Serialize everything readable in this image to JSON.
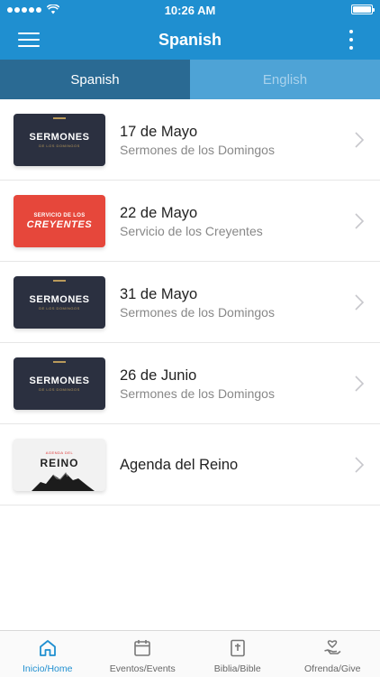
{
  "status_bar": {
    "time": "10:26 AM"
  },
  "header": {
    "title": "Spanish"
  },
  "tabs": [
    {
      "label": "Spanish",
      "active": true
    },
    {
      "label": "English",
      "active": false
    }
  ],
  "items": [
    {
      "title": "17 de Mayo",
      "subtitle": "Sermones de los Domingos",
      "thumb": {
        "main": "SERMONES",
        "sub": "DE LOS DOMINGOS"
      }
    },
    {
      "title": "22 de Mayo",
      "subtitle": "Servicio de los Creyentes",
      "thumb": {
        "line1": "SERVICIO DE LOS",
        "line2": "CREYENTES"
      }
    },
    {
      "title": "31 de Mayo",
      "subtitle": "Sermones de los Domingos",
      "thumb": {
        "main": "SERMONES",
        "sub": "DE LOS DOMINGOS"
      }
    },
    {
      "title": "26 de Junio",
      "subtitle": "Sermones de los Domingos",
      "thumb": {
        "main": "SERMONES",
        "sub": "DE LOS DOMINGOS"
      }
    },
    {
      "title": "Agenda del Reino",
      "thumb": {
        "top": "AGENDA DEL",
        "main": "REINO"
      }
    }
  ],
  "tabbar": [
    {
      "label": "Inicio/Home",
      "icon": "home-icon",
      "active": true
    },
    {
      "label": "Eventos/Events",
      "icon": "calendar-icon",
      "active": false
    },
    {
      "label": "Biblia/Bible",
      "icon": "bible-icon",
      "active": false
    },
    {
      "label": "Ofrenda/Give",
      "icon": "give-icon",
      "active": false
    }
  ],
  "colors": {
    "primary": "#1f8fd0",
    "tab_active": "#2a6a93",
    "tab_inactive": "#4ea3d6"
  }
}
